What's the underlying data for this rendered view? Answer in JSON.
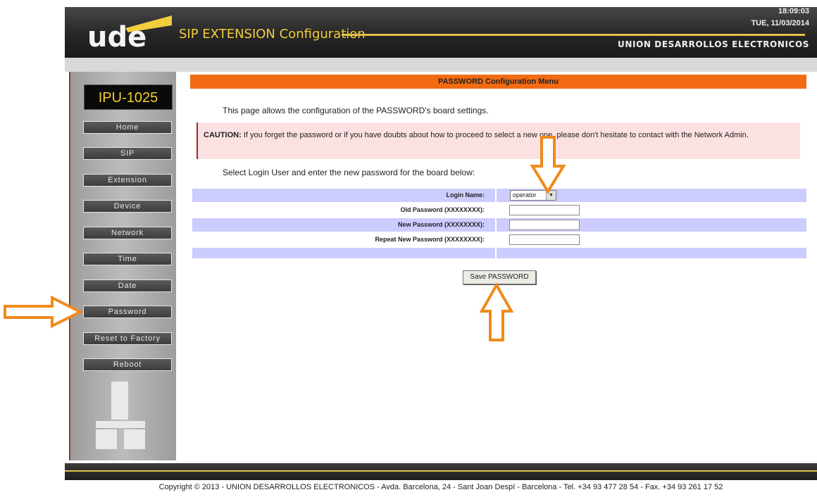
{
  "header": {
    "logo_text": "ude",
    "app_title": "SIP EXTENSION Configuration",
    "time": "18:09:03",
    "date": "TUE, 11/03/2014",
    "company": "UNION DESARROLLOS ELECTRONICOS"
  },
  "sidebar": {
    "device_name": "IPU-1025",
    "items": [
      {
        "label": "Home"
      },
      {
        "label": "SIP"
      },
      {
        "label": "Extension"
      },
      {
        "label": "Device"
      },
      {
        "label": "Network"
      },
      {
        "label": "Time"
      },
      {
        "label": "Date"
      },
      {
        "label": "Password"
      },
      {
        "label": "Reset to Factory"
      },
      {
        "label": "Reboot"
      }
    ]
  },
  "main": {
    "menu_title": "PASSWORD Configuration Menu",
    "intro": "This page allows the configuration of the PASSWORD's board settings.",
    "caution_label": "CAUTION:",
    "caution_text": " If you forget the password or if you have doubts about how to proceed to select a new one, please don't hesitate to contact with the Network Admin.",
    "select_prompt": "Select Login User and enter the new password for the board below:",
    "form": {
      "login_name_label": "Login Name:",
      "login_name_value": "operator",
      "old_password_label": "Old Password (XXXXXXXX):",
      "new_password_label": "New Password (XXXXXXXX):",
      "repeat_password_label": "Repeat New Password (XXXXXXXX):",
      "old_password_value": "",
      "new_password_value": "",
      "repeat_password_value": ""
    },
    "save_button": "Save PASSWORD"
  },
  "footer": {
    "copyright": "Copyright  © 2013 - UNION DESARROLLOS ELECTRONICOS  -  Avda. Barcelona, 24 - Sant Joan Despí  -  Barcelona  -  Tel. +34 93 477 28 54  -  Fax. +34 93 261 17 52"
  },
  "colors": {
    "accent_orange": "#f26b12",
    "header_gold": "#f2ce3c",
    "form_row_shade": "#ccccff",
    "caution_bg": "#fbe1e1",
    "annotation_arrow": "#f08a1c"
  }
}
